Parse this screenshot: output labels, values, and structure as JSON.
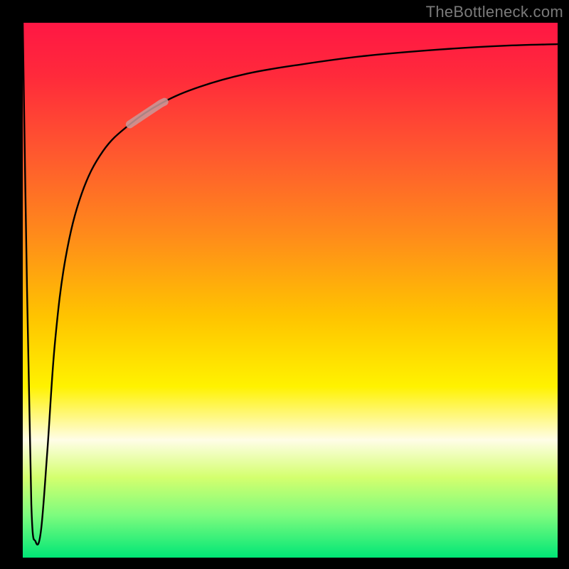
{
  "watermark": "TheBottleneck.com",
  "chart_data": {
    "type": "line",
    "title": "",
    "xlabel": "",
    "ylabel": "",
    "xlim": [
      0,
      1
    ],
    "ylim": [
      0,
      1
    ],
    "series": [
      {
        "name": "curve",
        "x": [
          0.0,
          0.008,
          0.016,
          0.024,
          0.034,
          0.046,
          0.06,
          0.08,
          0.11,
          0.15,
          0.2,
          0.26,
          0.33,
          0.42,
          0.52,
          0.64,
          0.78,
          0.9,
          1.0
        ],
        "y": [
          1.0,
          0.5,
          0.1,
          0.03,
          0.05,
          0.2,
          0.4,
          0.56,
          0.68,
          0.76,
          0.81,
          0.85,
          0.88,
          0.905,
          0.922,
          0.938,
          0.95,
          0.957,
          0.96
        ]
      }
    ],
    "highlight_segment": {
      "x_start": 0.2,
      "x_end": 0.265
    }
  },
  "colors": {
    "curve": "#000000",
    "highlight": "#c99a9a"
  }
}
